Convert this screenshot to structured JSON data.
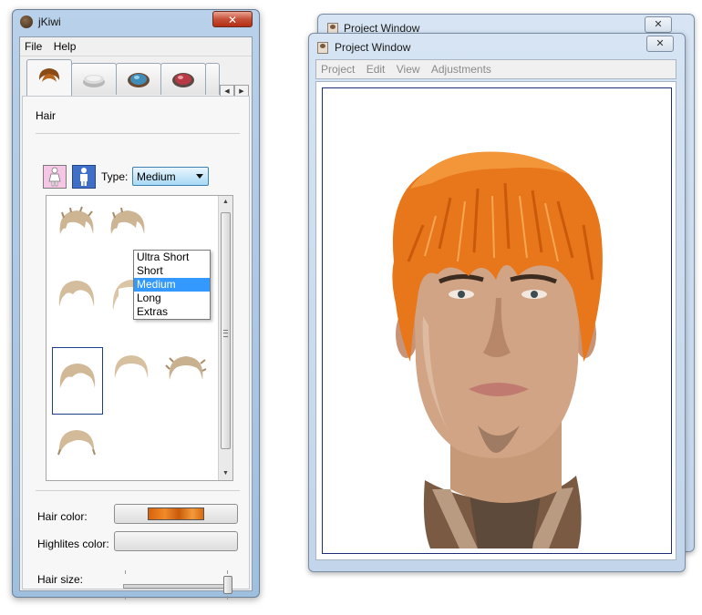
{
  "tool_window": {
    "title": "jKiwi",
    "close_symbol": "✕",
    "menu": [
      "File",
      "Help"
    ],
    "tabs": [
      {
        "icon": "hair-icon",
        "active": true
      },
      {
        "icon": "face-powder-icon",
        "active": false
      },
      {
        "icon": "eyeshadow-icon",
        "active": false
      },
      {
        "icon": "blush-icon",
        "active": false
      }
    ],
    "section_title": "Hair",
    "type_label": "Type:",
    "type_selected": "Medium",
    "type_options": [
      "Ultra Short",
      "Short",
      "Medium",
      "Long",
      "Extras"
    ],
    "hair_color_label": "Hair color:",
    "highlights_label": "Highlites color:",
    "hair_size_label": "Hair size:",
    "colors": {
      "hair": "#e8761a",
      "selection": "#3399ff"
    }
  },
  "project_windows": [
    {
      "title": "Project Window",
      "close_symbol": "✕"
    },
    {
      "title": "Project Window",
      "close_symbol": "✕"
    }
  ],
  "project_menu": [
    "Project",
    "Edit",
    "View",
    "Adjustments"
  ]
}
